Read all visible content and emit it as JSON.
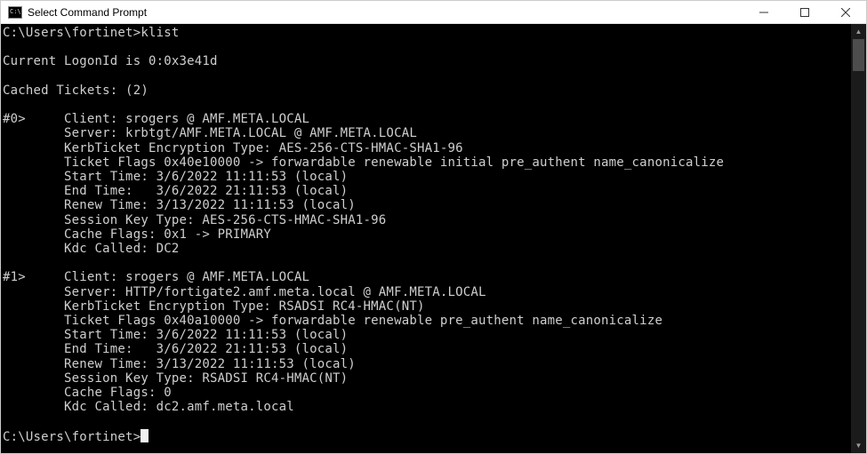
{
  "window": {
    "title": "Select Command Prompt"
  },
  "terminal": {
    "prompt_path": "C:\\Users\\fortinet>",
    "command": "klist",
    "logon_line": "Current LogonId is 0:0x3e41d",
    "cached_line": "Cached Tickets: (2)",
    "tickets": [
      {
        "index": "#0>",
        "client": "Client: srogers @ AMF.META.LOCAL",
        "server": "Server: krbtgt/AMF.META.LOCAL @ AMF.META.LOCAL",
        "enc": "KerbTicket Encryption Type: AES-256-CTS-HMAC-SHA1-96",
        "flags": "Ticket Flags 0x40e10000 -> forwardable renewable initial pre_authent name_canonicalize",
        "start": "Start Time: 3/6/2022 11:11:53 (local)",
        "end": "End Time:   3/6/2022 21:11:53 (local)",
        "renew": "Renew Time: 3/13/2022 11:11:53 (local)",
        "session": "Session Key Type: AES-256-CTS-HMAC-SHA1-96",
        "cache": "Cache Flags: 0x1 -> PRIMARY",
        "kdc": "Kdc Called: DC2"
      },
      {
        "index": "#1>",
        "client": "Client: srogers @ AMF.META.LOCAL",
        "server": "Server: HTTP/fortigate2.amf.meta.local @ AMF.META.LOCAL",
        "enc": "KerbTicket Encryption Type: RSADSI RC4-HMAC(NT)",
        "flags": "Ticket Flags 0x40a10000 -> forwardable renewable pre_authent name_canonicalize",
        "start": "Start Time: 3/6/2022 11:11:53 (local)",
        "end": "End Time:   3/6/2022 21:11:53 (local)",
        "renew": "Renew Time: 3/13/2022 11:11:53 (local)",
        "session": "Session Key Type: RSADSI RC4-HMAC(NT)",
        "cache": "Cache Flags: 0",
        "kdc": "Kdc Called: dc2.amf.meta.local"
      }
    ]
  }
}
